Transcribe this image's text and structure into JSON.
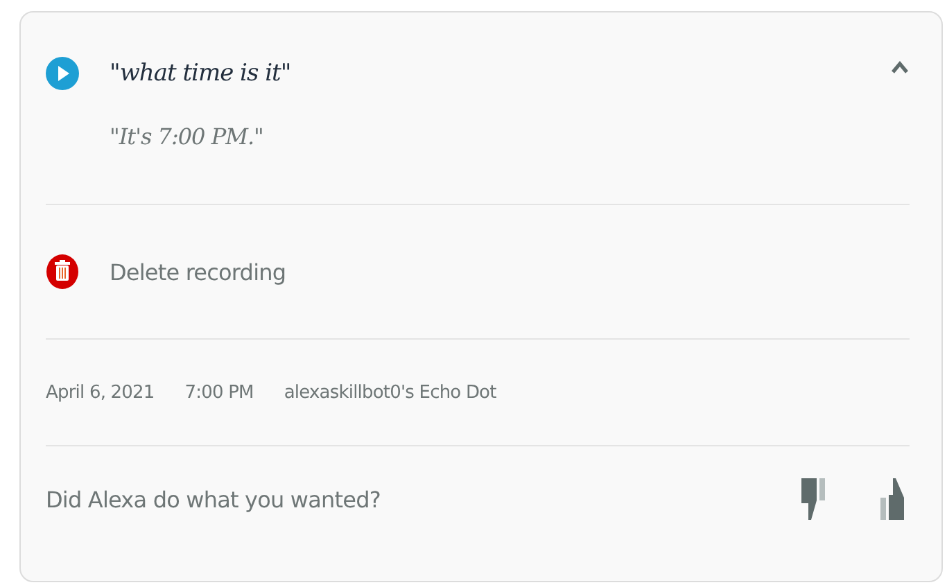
{
  "utterance": "\"what time is it\"",
  "expanded": true,
  "response": "\"It's 7:00 PM.\"",
  "delete_action": "Delete recording",
  "meta": {
    "date": "April 6, 2021",
    "time": "7:00 PM",
    "device": "alexaskillbot0's Echo Dot"
  },
  "feedback": {
    "question": "Did Alexa do what you wanted?"
  }
}
